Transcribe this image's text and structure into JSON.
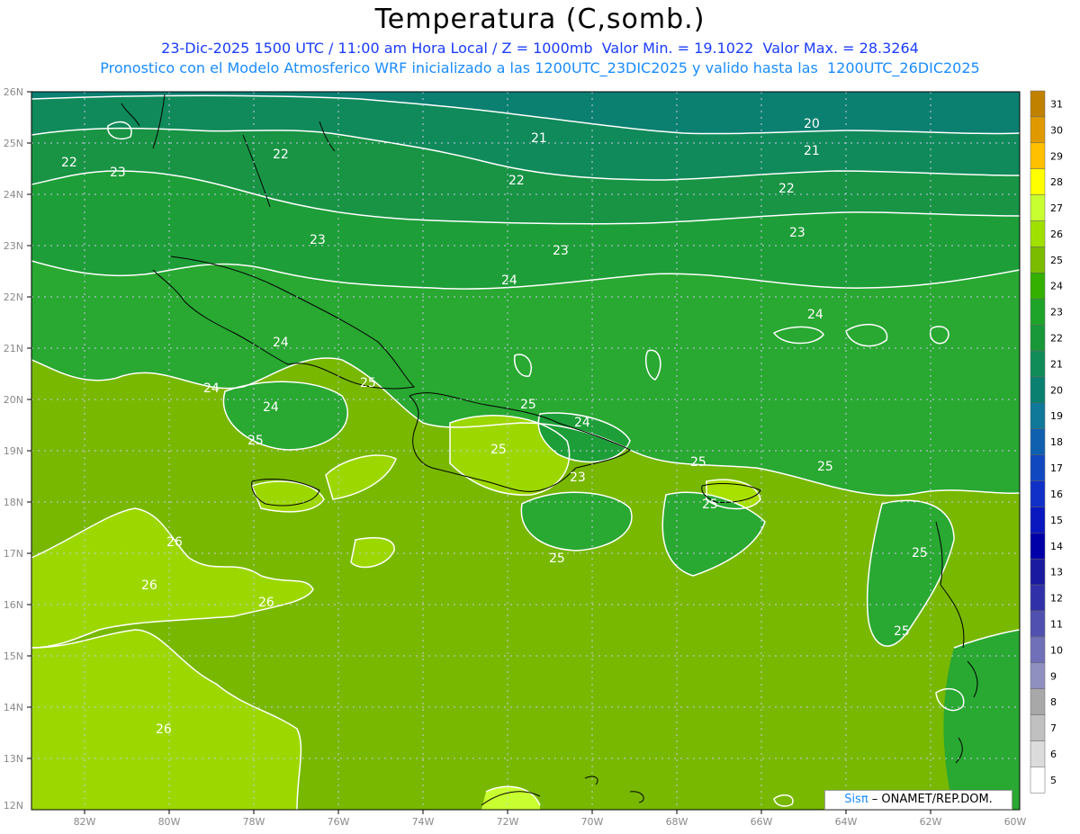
{
  "header": {
    "title": "Temperatura (C,somb.)",
    "line1": "23-Dic-2025 1500 UTC / 11:00 am Hora Local / Z = 1000mb  Valor Min. = 19.1022  Valor Max. = 28.3264",
    "line2": "Pronostico con el Modelo Atmosferico WRF inicializado a las 1200UTC_23DIC2025 y valido hasta las  1200UTC_26DIC2025"
  },
  "map": {
    "lat_labels": [
      "26N",
      "25N",
      "24N",
      "23N",
      "22N",
      "21N",
      "20N",
      "19N",
      "18N",
      "17N",
      "16N",
      "15N",
      "14N",
      "13N",
      "12N"
    ],
    "lon_labels": [
      "82W",
      "80W",
      "78W",
      "76W",
      "74W",
      "72W",
      "70W",
      "68W",
      "66W",
      "64W",
      "62W",
      "60W"
    ],
    "contour_labels": [
      {
        "text": "20"
      },
      {
        "text": "21"
      },
      {
        "text": "21"
      },
      {
        "text": "22"
      },
      {
        "text": "22"
      },
      {
        "text": "22"
      },
      {
        "text": "23"
      },
      {
        "text": "23"
      },
      {
        "text": "23"
      },
      {
        "text": "23"
      },
      {
        "text": "24"
      },
      {
        "text": "24"
      },
      {
        "text": "24"
      },
      {
        "text": "24"
      },
      {
        "text": "24"
      },
      {
        "text": "24"
      },
      {
        "text": "25"
      },
      {
        "text": "25"
      },
      {
        "text": "25"
      },
      {
        "text": "25"
      },
      {
        "text": "25"
      },
      {
        "text": "25"
      },
      {
        "text": "25"
      },
      {
        "text": "25"
      },
      {
        "text": "25"
      },
      {
        "text": "25"
      },
      {
        "text": "23"
      },
      {
        "text": "26"
      },
      {
        "text": "26"
      },
      {
        "text": "26"
      },
      {
        "text": "26"
      },
      {
        "text": "22"
      }
    ]
  },
  "colorbar": {
    "labels": [
      "31",
      "30",
      "29",
      "28",
      "27",
      "26",
      "25",
      "24",
      "23",
      "22",
      "21",
      "20",
      "19",
      "18",
      "17",
      "16",
      "15",
      "14",
      "13",
      "12",
      "11",
      "10",
      "9",
      "8",
      "7",
      "6",
      "5"
    ],
    "colors": [
      "#c08000",
      "#e09a00",
      "#ffc000",
      "#ffff00",
      "#c8ff30",
      "#a0e000",
      "#7cbc00",
      "#34b000",
      "#1ea428",
      "#189838",
      "#108c58",
      "#0a8070",
      "#107898",
      "#1060b0",
      "#1048c0",
      "#1030c8",
      "#0a18c0",
      "#0000a8",
      "#1a1aa0",
      "#3030a8",
      "#5050b0",
      "#7070b8",
      "#9090c0",
      "#a8a8a8",
      "#c0c0c0",
      "#dcdcdc",
      "#ffffff"
    ]
  },
  "credit": {
    "sis": "Sisπ",
    "rest": " – ONAMET/REP.DOM."
  }
}
